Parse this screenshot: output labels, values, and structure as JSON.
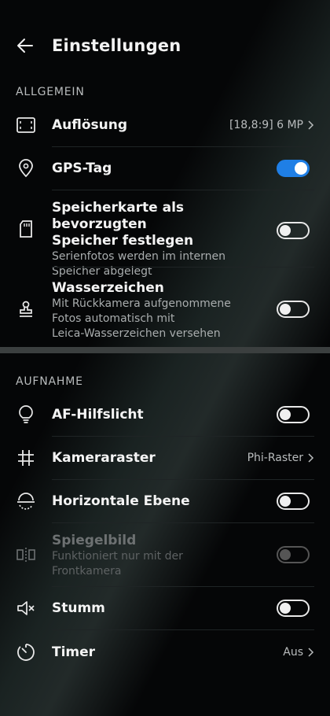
{
  "header": {
    "title": "Einstellungen"
  },
  "sections": {
    "general": "ALLGEMEIN",
    "capture": "AUFNAHME"
  },
  "items": {
    "resolution": {
      "label": "Auflösung",
      "value": "[18,8:9] 6 MP",
      "icon": "resolution-icon"
    },
    "gps": {
      "label": "GPS-Tag",
      "toggle": true,
      "icon": "location-pin-icon"
    },
    "sdcard": {
      "label_line1": "Speicherkarte als bevorzugten",
      "label_line2": "Speicher festlegen",
      "sub_line1": "Serienfotos werden im internen",
      "sub_line2": "Speicher abgelegt",
      "toggle": false,
      "icon": "sd-card-icon"
    },
    "watermark": {
      "label": "Wasserzeichen",
      "sub_line1": "Mit Rückkamera aufgenommene",
      "sub_line2": "Fotos automatisch mit",
      "sub_line3": "Leica-Wasserzeichen versehen",
      "toggle": false,
      "icon": "stamp-icon"
    },
    "af_light": {
      "label": "AF-Hilfslicht",
      "toggle": false,
      "icon": "lightbulb-icon"
    },
    "grid": {
      "label": "Kameraraster",
      "value": "Phi-Raster",
      "icon": "grid-hash-icon"
    },
    "level": {
      "label": "Horizontale Ebene",
      "toggle": false,
      "icon": "horizon-level-icon"
    },
    "mirror": {
      "label": "Spiegelbild",
      "sub_line1": "Funktioniert nur mit der",
      "sub_line2": "Frontkamera",
      "toggle": false,
      "disabled": true,
      "icon": "mirror-icon"
    },
    "mute": {
      "label": "Stumm",
      "toggle": false,
      "icon": "mute-speaker-icon"
    },
    "timer": {
      "label": "Timer",
      "value": "Aus",
      "icon": "timer-icon"
    }
  },
  "colors": {
    "accent": "#1f7fe6",
    "background": "#050607"
  }
}
